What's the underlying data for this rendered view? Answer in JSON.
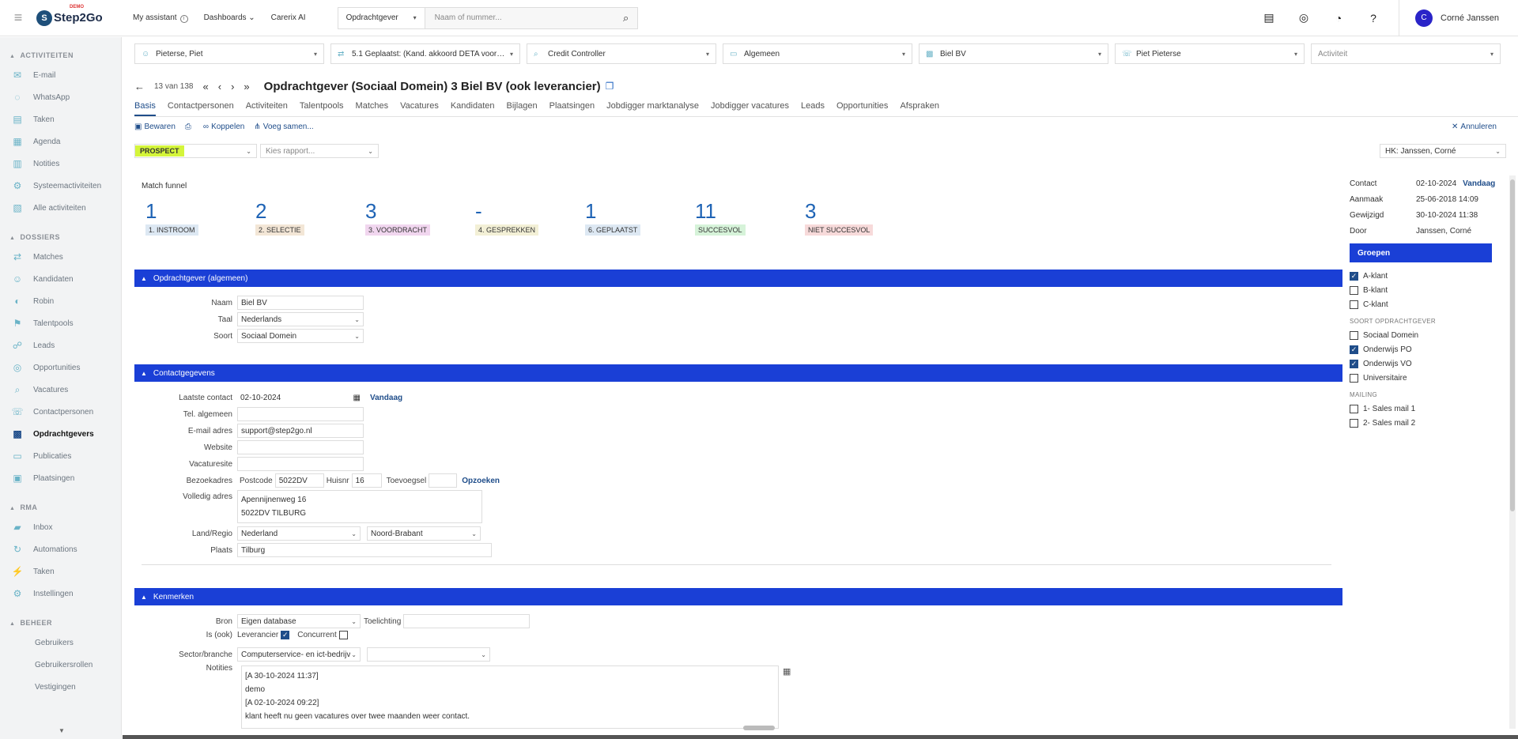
{
  "topbar": {
    "logo_demo": "DEMO",
    "logo_text": "Step2Go",
    "nav": [
      "My assistant",
      "Dashboards",
      "Carerix AI"
    ],
    "search_type": "Opdrachtgever",
    "search_placeholder": "Naam of nummer...",
    "user_initial": "C",
    "user_name": "Corné Janssen"
  },
  "sidebar": {
    "sections": [
      {
        "title": "ACTIVITEITEN",
        "items": [
          {
            "label": "E-mail",
            "icon": "✉"
          },
          {
            "label": "WhatsApp",
            "icon": "◌"
          },
          {
            "label": "Taken",
            "icon": "▤"
          },
          {
            "label": "Agenda",
            "icon": "▦"
          },
          {
            "label": "Notities",
            "icon": "▥"
          },
          {
            "label": "Systeemactiviteiten",
            "icon": "⚙"
          },
          {
            "label": "Alle activiteiten",
            "icon": "▧"
          }
        ]
      },
      {
        "title": "DOSSIERS",
        "items": [
          {
            "label": "Matches",
            "icon": "⇄"
          },
          {
            "label": "Kandidaten",
            "icon": "☺"
          },
          {
            "label": "Robin",
            "icon": "◐"
          },
          {
            "label": "Talentpools",
            "icon": "⚑"
          },
          {
            "label": "Leads",
            "icon": "☍"
          },
          {
            "label": "Opportunities",
            "icon": "◎"
          },
          {
            "label": "Vacatures",
            "icon": "⌕"
          },
          {
            "label": "Contactpersonen",
            "icon": "☏"
          },
          {
            "label": "Opdrachtgevers",
            "icon": "▩"
          },
          {
            "label": "Publicaties",
            "icon": "▭"
          },
          {
            "label": "Plaatsingen",
            "icon": "▣"
          }
        ]
      },
      {
        "title": "RMA",
        "items": [
          {
            "label": "Inbox",
            "icon": "▰"
          },
          {
            "label": "Automations",
            "icon": "↻"
          },
          {
            "label": "Taken",
            "icon": "⚡"
          },
          {
            "label": "Instellingen",
            "icon": "⚙"
          }
        ]
      },
      {
        "title": "BEHEER",
        "items": [
          {
            "label": "Gebruikers",
            "icon": ""
          },
          {
            "label": "Gebruikersrollen",
            "icon": ""
          },
          {
            "label": "Vestigingen",
            "icon": ""
          }
        ]
      }
    ]
  },
  "filters": [
    {
      "label": "Pieterse, Piet",
      "placeholder": false
    },
    {
      "label": "5.1 Geplaatst: (Kand. akkoord DETA voorst...",
      "placeholder": false
    },
    {
      "label": "Credit Controller",
      "placeholder": false
    },
    {
      "label": "Algemeen",
      "placeholder": false
    },
    {
      "label": "Biel BV",
      "placeholder": false
    },
    {
      "label": "Piet Pieterse",
      "placeholder": false
    },
    {
      "label": "Activiteit",
      "placeholder": true
    }
  ],
  "record": {
    "counter": "13 van 138",
    "title": "Opdrachtgever (Sociaal Domein) 3 Biel BV (ook leverancier)"
  },
  "tabs": [
    "Basis",
    "Contactpersonen",
    "Activiteiten",
    "Talentpools",
    "Matches",
    "Vacatures",
    "Kandidaten",
    "Bijlagen",
    "Plaatsingen",
    "Jobdigger marktanalyse",
    "Jobdigger vacatures",
    "Leads",
    "Opportunities",
    "Afspraken"
  ],
  "actions": {
    "save": "Bewaren",
    "link": "Koppelen",
    "merge": "Voeg samen...",
    "cancel": "Annuleren"
  },
  "status": {
    "badge": "PROSPECT",
    "report_placeholder": "Kies rapport...",
    "hk": "HK: Janssen, Corné"
  },
  "funnel": {
    "title": "Match funnel",
    "steps": [
      {
        "num": "1",
        "label": "1. INSTROOM",
        "color": "#dde8f3"
      },
      {
        "num": "2",
        "label": "2. SELECTIE",
        "color": "#f3e6d6"
      },
      {
        "num": "3",
        "label": "3. VOORDRACHT",
        "color": "#f1d6ef"
      },
      {
        "num": "-",
        "label": "4. GESPREKKEN",
        "color": "#f3f0d6"
      },
      {
        "num": "1",
        "label": "6. GEPLAATST",
        "color": "#dde8f3"
      },
      {
        "num": "11",
        "label": "SUCCESVOL",
        "color": "#d6f3d9"
      },
      {
        "num": "3",
        "label": "NIET SUCCESVOL",
        "color": "#f7dada"
      }
    ]
  },
  "sections": {
    "general": "Opdrachtgever (algemeen)",
    "contact": "Contactgegevens",
    "features": "Kenmerken"
  },
  "general": {
    "name_label": "Naam",
    "name": "Biel BV",
    "lang_label": "Taal",
    "lang": "Nederlands",
    "type_label": "Soort",
    "type": "Sociaal Domein"
  },
  "contact": {
    "last_label": "Laatste contact",
    "last": "02-10-2024",
    "today": "Vandaag",
    "tel_label": "Tel. algemeen",
    "tel": "",
    "email_label": "E-mail adres",
    "email": "support@step2go.nl",
    "web_label": "Website",
    "web": "",
    "vac_label": "Vacaturesite",
    "vac": "",
    "addr_label": "Bezoekadres",
    "postcode_label": "Postcode",
    "postcode": "5022DV",
    "house_label": "Huisnr",
    "house": "16",
    "add_label": "Toevoegsel",
    "add": "",
    "lookup": "Opzoeken",
    "full_label": "Volledig adres",
    "full1": "Apennijnenweg 16",
    "full2": "5022DV  TILBURG",
    "country_label": "Land/Regio",
    "country": "Nederland",
    "region": "Noord-Brabant",
    "city_label": "Plaats",
    "city": "Tilburg"
  },
  "features": {
    "source_label": "Bron",
    "source": "Eigen database",
    "expl_label": "Toelichting",
    "expl": "",
    "is_label": "Is (ook)",
    "supplier": "Leverancier",
    "competitor": "Concurrent",
    "sector_label": "Sector/branche",
    "sector": "Computerservice- en ict-bedrijv",
    "notes_label": "Notities",
    "notes": [
      "[A 30-10-2024 11:37]",
      "demo",
      "[A 02-10-2024 09:22]",
      "klant heeft nu geen vacatures over twee maanden weer contact."
    ]
  },
  "right": {
    "contact_label": "Contact",
    "contact": "02-10-2024",
    "contact_today": "Vandaag",
    "created_label": "Aanmaak",
    "created": "25-06-2018 14:09",
    "changed_label": "Gewijzigd",
    "changed": "30-10-2024 11:38",
    "by_label": "Door",
    "by": "Janssen, Corné",
    "groups": "Groepen",
    "groups_items": [
      {
        "label": "A-klant",
        "on": true
      },
      {
        "label": "B-klant",
        "on": false
      },
      {
        "label": "C-klant",
        "on": false
      }
    ],
    "type_title": "SOORT OPDRACHTGEVER",
    "type_items": [
      {
        "label": "Sociaal Domein",
        "on": false
      },
      {
        "label": "Onderwijs PO",
        "on": true
      },
      {
        "label": "Onderwijs VO",
        "on": true
      },
      {
        "label": "Universitaire",
        "on": false
      }
    ],
    "mailing_title": "MAILING",
    "mailing_items": [
      {
        "label": "1- Sales mail 1",
        "on": false
      },
      {
        "label": "2- Sales mail 2",
        "on": false
      }
    ]
  }
}
